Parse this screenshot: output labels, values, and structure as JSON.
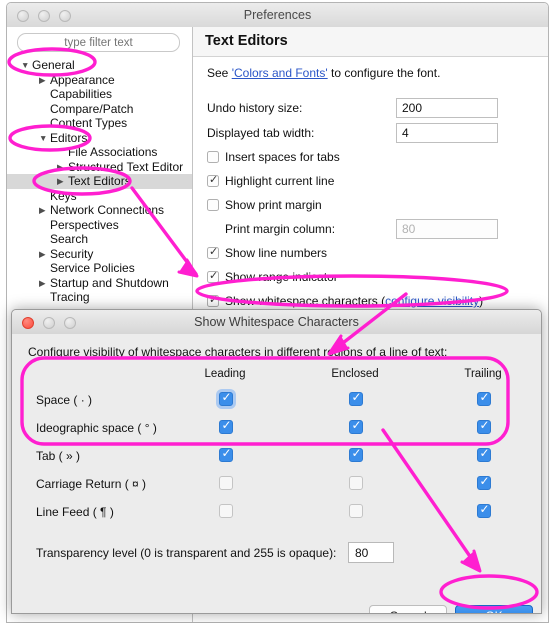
{
  "window": {
    "title": "Preferences",
    "traffic_lights": [
      "close",
      "minimize",
      "zoom"
    ]
  },
  "sidebar": {
    "filter_placeholder": "type filter text",
    "items": [
      {
        "label": "General",
        "indent": 0,
        "twisty": "open",
        "selected": false
      },
      {
        "label": "Appearance",
        "indent": 1,
        "twisty": "closed",
        "selected": false
      },
      {
        "label": "Capabilities",
        "indent": 1,
        "twisty": "none",
        "selected": false
      },
      {
        "label": "Compare/Patch",
        "indent": 1,
        "twisty": "none",
        "selected": false
      },
      {
        "label": "Content Types",
        "indent": 1,
        "twisty": "none",
        "selected": false
      },
      {
        "label": "Editors",
        "indent": 1,
        "twisty": "open",
        "selected": false
      },
      {
        "label": "File Associations",
        "indent": 2,
        "twisty": "none",
        "selected": false
      },
      {
        "label": "Structured Text Editor",
        "indent": 2,
        "twisty": "closed",
        "selected": false
      },
      {
        "label": "Text Editors",
        "indent": 2,
        "twisty": "closed",
        "selected": true
      },
      {
        "label": "Keys",
        "indent": 1,
        "twisty": "none",
        "selected": false
      },
      {
        "label": "Network Connections",
        "indent": 1,
        "twisty": "closed",
        "selected": false
      },
      {
        "label": "Perspectives",
        "indent": 1,
        "twisty": "none",
        "selected": false
      },
      {
        "label": "Search",
        "indent": 1,
        "twisty": "none",
        "selected": false
      },
      {
        "label": "Security",
        "indent": 1,
        "twisty": "closed",
        "selected": false
      },
      {
        "label": "Service Policies",
        "indent": 1,
        "twisty": "none",
        "selected": false
      },
      {
        "label": "Startup and Shutdown",
        "indent": 1,
        "twisty": "closed",
        "selected": false
      },
      {
        "label": "Tracing",
        "indent": 1,
        "twisty": "none",
        "selected": false
      }
    ]
  },
  "page": {
    "title": "Text Editors",
    "intro_before": "See ",
    "intro_link": "'Colors and Fonts'",
    "intro_after": " to configure the font.",
    "fields": [
      {
        "label": "Undo history size:",
        "value": "200",
        "enabled": true
      },
      {
        "label": "Displayed tab width:",
        "value": "4",
        "enabled": true
      }
    ],
    "print_margin_field": {
      "label": "Print margin column:",
      "value": "80",
      "enabled": false
    },
    "checkboxes": [
      {
        "label": "Insert spaces for tabs",
        "checked": false
      },
      {
        "label": "Highlight current line",
        "checked": true
      },
      {
        "label": "Show print margin",
        "checked": false
      },
      {
        "label": "Show line numbers",
        "checked": true
      },
      {
        "label": "Show range indicator",
        "checked": true
      }
    ],
    "whitespace_checkbox": {
      "checked": true,
      "text_before": "Show whitespace characters (",
      "link": "configure visibility",
      "text_after": ")"
    }
  },
  "dialog": {
    "title": "Show Whitespace Characters",
    "description": "Configure visibility of whitespace characters in different regions of a line of text:",
    "columns": [
      "Leading",
      "Enclosed",
      "Trailing"
    ],
    "rows": [
      {
        "label": "Space ( · )",
        "leading": true,
        "enclosed": true,
        "trailing": true,
        "focused": true
      },
      {
        "label": "Ideographic space ( ° )",
        "leading": true,
        "enclosed": true,
        "trailing": true,
        "focused": false
      },
      {
        "label": "Tab ( » )",
        "leading": true,
        "enclosed": true,
        "trailing": true,
        "focused": false
      },
      {
        "label": "Carriage Return ( ¤ )",
        "leading": false,
        "enclosed": false,
        "trailing": true,
        "focused": false
      },
      {
        "label": "Line Feed ( ¶ )",
        "leading": false,
        "enclosed": false,
        "trailing": true,
        "focused": false
      }
    ],
    "transparency_label": "Transparency level (0 is transparent and 255 is opaque):",
    "transparency_value": "80",
    "cancel_label": "Cancel",
    "ok_label": "OK"
  },
  "colors": {
    "annotation": "#ff1fd0",
    "link": "#2b56c8",
    "accent_checkbox": "#3b8eea",
    "ok_button": "#1874db",
    "selection_row": "#d8d8d8"
  }
}
